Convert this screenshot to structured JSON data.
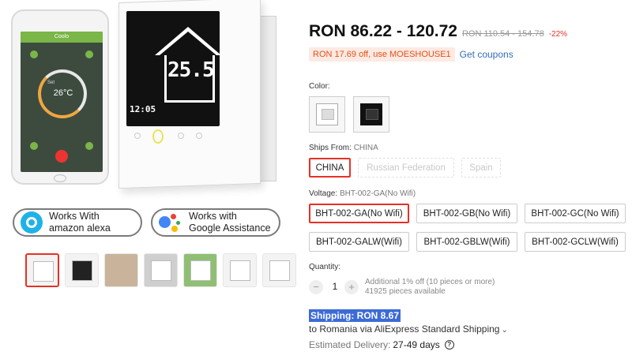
{
  "gallery": {
    "phone_bar": "Coolo",
    "phone_set": "Set",
    "phone_temp": "26°C",
    "thermo_temp": "25.5",
    "thermo_clock": "12:05",
    "badges": [
      {
        "line1": "Works With",
        "line2": "amazon alexa"
      },
      {
        "line1": "Works with",
        "line2": "Google Assistance"
      }
    ],
    "thumbnails": [
      "thumb-1",
      "thumb-2",
      "thumb-3",
      "thumb-4",
      "thumb-5",
      "thumb-6",
      "thumb-7"
    ]
  },
  "price": {
    "range": "RON 86.22 - 120.72",
    "original": "RON 110.54 - 154.78",
    "discount": "-22%"
  },
  "coupon": {
    "text": "RON 17.69 off, use MOESHOUSE1",
    "link": "Get coupons"
  },
  "color": {
    "label": "Color:",
    "options": [
      "white",
      "black"
    ],
    "selected": "white"
  },
  "ships_from": {
    "label": "Ships From:",
    "value": "CHINA",
    "options": [
      "CHINA",
      "Russian Federation",
      "Spain"
    ]
  },
  "voltage": {
    "label": "Voltage:",
    "value": "BHT-002-GA(No Wifi)",
    "options": [
      "BHT-002-GA(No Wifi)",
      "BHT-002-GB(No Wifi)",
      "BHT-002-GC(No Wifi)",
      "BHT-002-GALW(Wifi)",
      "BHT-002-GBLW(Wifi)",
      "BHT-002-GCLW(Wifi)"
    ]
  },
  "quantity": {
    "label": "Quantity:",
    "minus": "−",
    "value": "1",
    "plus": "+",
    "note_line1": "Additional 1% off (10 pieces or more)",
    "note_line2": "41925 pieces available"
  },
  "shipping": {
    "title": "Shipping: RON 8.67",
    "via": "to Romania via AliExpress Standard Shipping",
    "delivery_label": "Estimated Delivery:",
    "delivery_days": "27-49 days",
    "help": "?"
  },
  "colors": {
    "accent_red": "#e43225",
    "link_blue": "#2f6fbe",
    "highlight_blue": "#3d6bd6"
  }
}
